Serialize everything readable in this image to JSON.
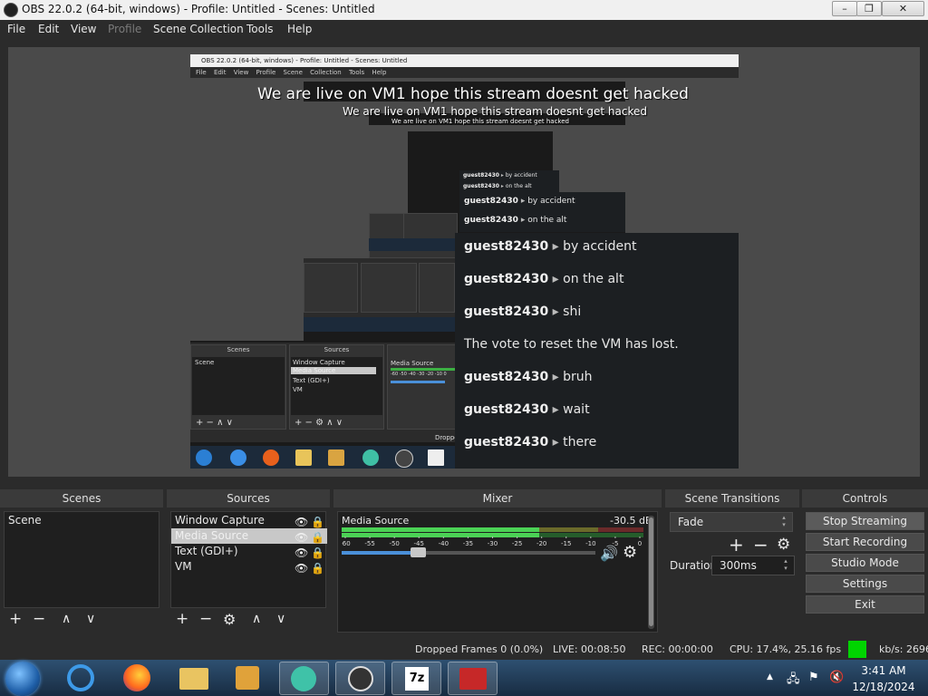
{
  "window": {
    "title": "OBS 22.0.2 (64-bit, windows) - Profile: Untitled - Scenes: Untitled",
    "minimize": "–",
    "maximize": "❐",
    "close": "✕"
  },
  "menu": [
    "File",
    "Edit",
    "View",
    "Profile",
    "Scene Collection",
    "Tools",
    "Help"
  ],
  "preview": {
    "nested_title": "OBS 22.0.2 (64-bit, windows) - Profile: Untitled - Scenes: Untitled",
    "nested_menu": "File Edit View Profile Scene Collection Tools Help",
    "overlay_text": "We are live on VM1 hope this stream doesnt get hacked",
    "nested_docks": {
      "scenes_header": "Scenes",
      "sources_header": "Sources",
      "scene_item": "Scene",
      "sources": [
        "Window Capture",
        "Media Source",
        "Text (GDI+)",
        "VM"
      ],
      "mixer_item": "Media Source",
      "mixer_ticks": "-60  -50  -40  -30  -20  -10  0",
      "dropped_text": "Droppe"
    },
    "chat_small": [
      {
        "user": "guest82430",
        "msg": "by accident"
      },
      {
        "user": "guest82430",
        "msg": "on the alt"
      }
    ],
    "chat_mid": [
      {
        "user": "guest82430",
        "msg": "by accident"
      },
      {
        "user": "guest82430",
        "msg": "on the alt"
      }
    ],
    "chat": [
      {
        "user": "guest82430",
        "msg": "by accident"
      },
      {
        "user": "guest82430",
        "msg": "on the alt"
      },
      {
        "user": "guest82430",
        "msg": "shi"
      },
      {
        "user": "",
        "msg": "The vote to reset the VM has lost."
      },
      {
        "user": "guest82430",
        "msg": "bruh"
      },
      {
        "user": "guest82430",
        "msg": "wait"
      },
      {
        "user": "guest82430",
        "msg": "there"
      }
    ]
  },
  "scenes": {
    "header": "Scenes",
    "items": [
      "Scene"
    ]
  },
  "sources": {
    "header": "Sources",
    "items": [
      "Window Capture",
      "Media Source",
      "Text (GDI+)",
      "VM"
    ],
    "selected_index": 1
  },
  "mixer": {
    "header": "Mixer",
    "channel": "Media Source",
    "level": "-30.5 dB",
    "ticks": [
      "-60",
      "-55",
      "-50",
      "-45",
      "-40",
      "-35",
      "-30",
      "-25",
      "-20",
      "-15",
      "-10",
      "-5",
      "0"
    ],
    "volume_fraction": 0.3
  },
  "transitions": {
    "header": "Scene Transitions",
    "selected": "Fade",
    "duration_label": "Duration",
    "duration_value": "300ms"
  },
  "controls": {
    "header": "Controls",
    "stop_streaming": "Stop Streaming",
    "start_recording": "Start Recording",
    "studio_mode": "Studio Mode",
    "settings": "Settings",
    "exit": "Exit"
  },
  "status": {
    "dropped": "Dropped Frames 0 (0.0%)",
    "live": "LIVE: 00:08:50",
    "rec": "REC: 00:00:00",
    "cpu": "CPU: 17.4%, 25.16 fps",
    "kbps": "kb/s: 2696",
    "health_color": "#00d400"
  },
  "taskbar": {
    "icons": [
      "start-orb",
      "internet-explorer",
      "firefox",
      "file-explorer",
      "media-player",
      "vm-app",
      "obs",
      "7zip",
      "toolbox"
    ],
    "time": "3:41 AM",
    "date": "12/18/2024"
  }
}
